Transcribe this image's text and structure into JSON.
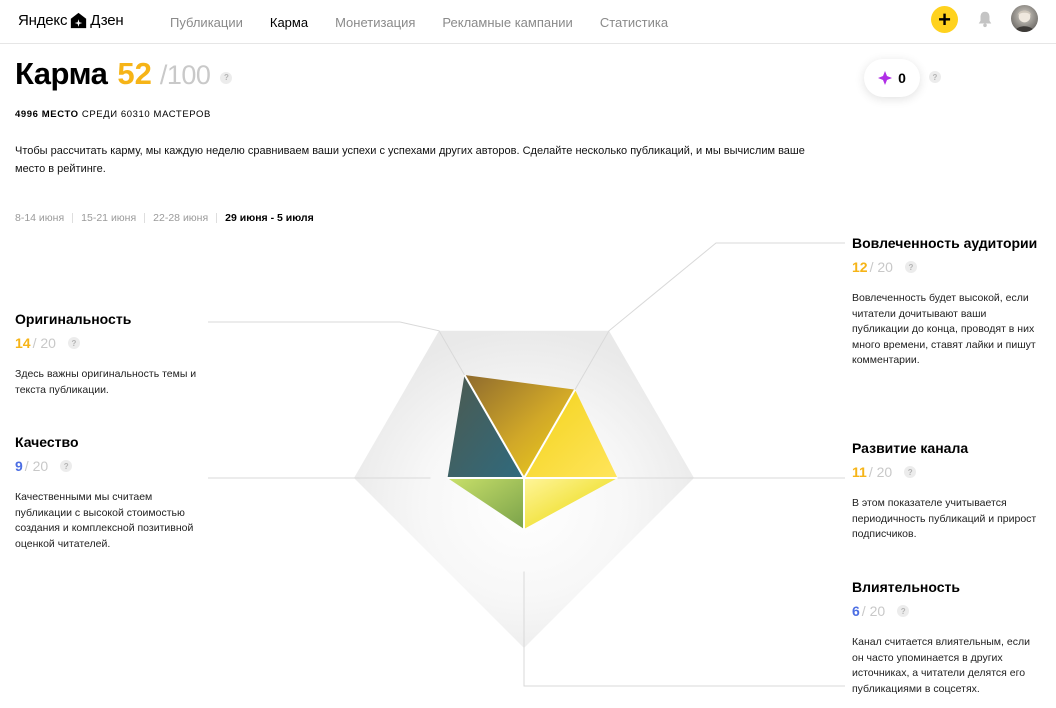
{
  "header": {
    "logo_left": "Яндекс",
    "logo_right": "Дзен",
    "nav": [
      {
        "label": "Публикации",
        "active": false
      },
      {
        "label": "Карма",
        "active": true
      },
      {
        "label": "Монетизация",
        "active": false
      },
      {
        "label": "Рекламные кампании",
        "active": false
      },
      {
        "label": "Статистика",
        "active": false
      }
    ],
    "plus_label": "+"
  },
  "karma": {
    "title": "Карма",
    "value": "52",
    "max": "/100",
    "rank_place": "4996 место",
    "rank_rest": "среди 60310 мастеров",
    "description": "Чтобы рассчитать карму, мы каждую неделю сравниваем ваши успехи с успехами других авторов. Сделайте несколько публикаций, и мы вычислим ваше место в рейтинге.",
    "weeks": [
      {
        "label": "8-14 июня",
        "active": false
      },
      {
        "label": "15-21 июня",
        "active": false
      },
      {
        "label": "22-28 июня",
        "active": false
      },
      {
        "label": "29 июня - 5 июля",
        "active": true
      }
    ],
    "badge_count": "0",
    "qmark": "?"
  },
  "metrics": {
    "originality": {
      "title": "Оригинальность",
      "value": "14",
      "max": "/ 20",
      "description": "Здесь важны оригинальность темы и текста публикации."
    },
    "quality": {
      "title": "Качество",
      "value": "9",
      "max": "/ 20",
      "description": "Качественными мы считаем публикации с высокой стоимостью создания и комплексной позитивной оценкой читателей."
    },
    "engagement": {
      "title": "Вовлеченность аудитории",
      "value": "12",
      "max": "/ 20",
      "description": "Вовлеченность будет высокой, если читатели дочитывают ваши публикации до конца, проводят в них много времени, ставят лайки и пишут комментарии."
    },
    "development": {
      "title": "Развитие канала",
      "value": "11",
      "max": "/ 20",
      "description": "В этом показателе учитывается периодичность публикаций и прирост подписчиков."
    },
    "influence": {
      "title": "Влиятельность",
      "value": "6",
      "max": "/ 20",
      "description": "Канал считается влиятельным, если он часто упоминается в других источниках, а читатели делятся его публикациями в соцсетях."
    }
  },
  "colors": {
    "accent_yellow": "#f6b417",
    "accent_blue": "#4c6ee3",
    "plus_button": "#ffd21e",
    "badge_diamond": "#b02ee6"
  },
  "icons": {
    "plus": "plus-icon",
    "bell": "bell-icon",
    "avatar": "avatar-image",
    "diamond": "diamond-icon",
    "help": "question-icon"
  },
  "chart_data": {
    "type": "radar",
    "axes": [
      "Вовлеченность аудитории",
      "Развитие канала",
      "Влиятельность",
      "Качество",
      "Оригинальность"
    ],
    "values": [
      12,
      11,
      6,
      9,
      14
    ],
    "max": 20
  }
}
